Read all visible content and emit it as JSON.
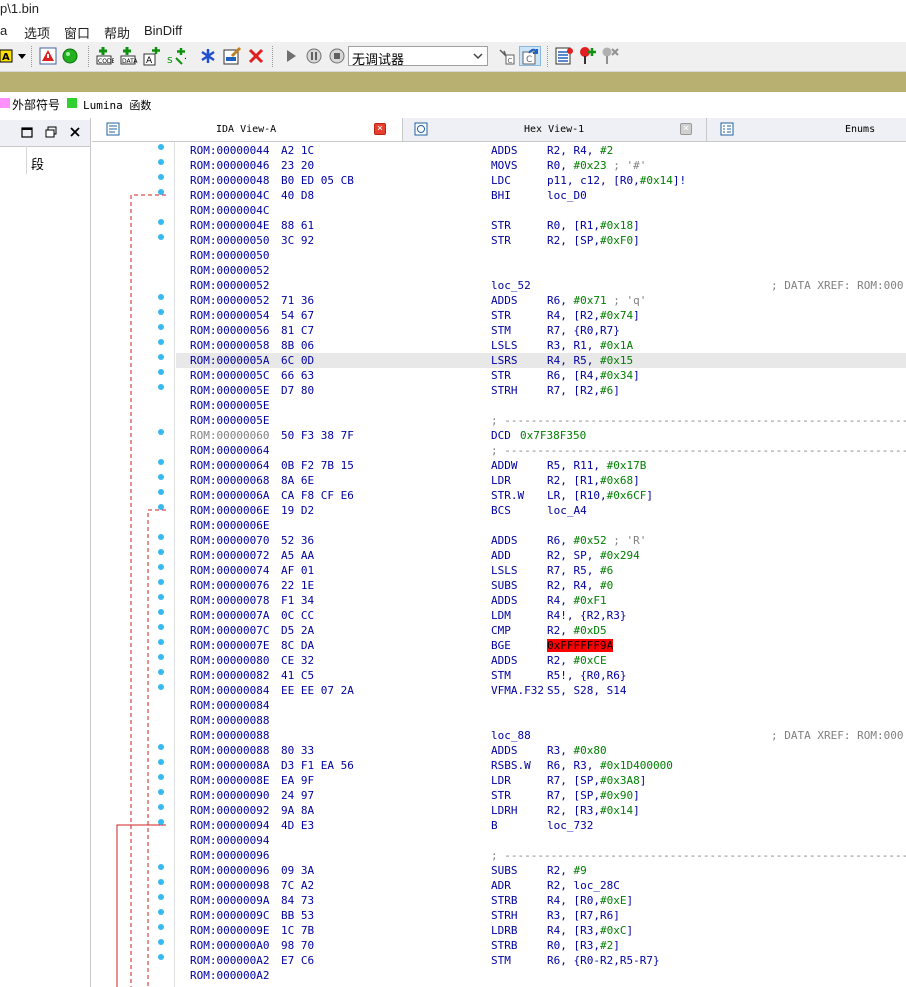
{
  "window": {
    "title": "p\\1.bin"
  },
  "menu": [
    "a",
    "选项",
    "窗口",
    "帮助",
    "BinDiff"
  ],
  "toolbar": {
    "debugger_select": "无调试器"
  },
  "legend": [
    {
      "color": "#ff90ff",
      "label": "外部符号"
    },
    {
      "color": "#30d030",
      "label": "Lumina 函数"
    }
  ],
  "left_panel": {
    "segment_label": "段"
  },
  "tabs": [
    {
      "label": "IDA View-A",
      "icon": "ida-view-icon"
    },
    {
      "label": "Hex View-1",
      "icon": "hex-view-icon"
    },
    {
      "label": "Enums",
      "icon": "enums-icon"
    }
  ],
  "listing": [
    {
      "addr": "ROM:00000044",
      "bytes": "A2 1C",
      "mnem": "ADDS",
      "ops": "R2, R4, #2",
      "dot": true
    },
    {
      "addr": "ROM:00000046",
      "bytes": "23 20",
      "mnem": "MOVS",
      "ops": "R0, #0x23 ; '#'",
      "dot": true
    },
    {
      "addr": "ROM:00000048",
      "bytes": "B0 ED 05 CB",
      "mnem": "LDC",
      "ops": "p11, c12, [R0,#0x14]!",
      "dot": true
    },
    {
      "addr": "ROM:0000004C",
      "bytes": "40 D8",
      "mnem": "BHI",
      "ops": "loc_D0",
      "dot": true
    },
    {
      "addr": "ROM:0000004C",
      "bytes": "",
      "mnem": "",
      "ops": "",
      "dot": false
    },
    {
      "addr": "ROM:0000004E",
      "bytes": "88 61",
      "mnem": "STR",
      "ops": "R0, [R1,#0x18]",
      "dot": true
    },
    {
      "addr": "ROM:00000050",
      "bytes": "3C 92",
      "mnem": "STR",
      "ops": "R2, [SP,#0xF0]",
      "dot": true
    },
    {
      "addr": "ROM:00000050",
      "bytes": "",
      "mnem": "",
      "ops": "",
      "dot": false
    },
    {
      "addr": "ROM:00000052",
      "bytes": "",
      "mnem": "",
      "ops": "",
      "dot": false
    },
    {
      "addr": "ROM:00000052",
      "bytes": "",
      "label": "loc_52",
      "xref": "; DATA XREF: ROM:000",
      "dot": false
    },
    {
      "addr": "ROM:00000052",
      "bytes": "71 36",
      "mnem": "ADDS",
      "ops": "R6, #0x71 ; 'q'",
      "dot": true
    },
    {
      "addr": "ROM:00000054",
      "bytes": "54 67",
      "mnem": "STR",
      "ops": "R4, [R2,#0x74]",
      "dot": true
    },
    {
      "addr": "ROM:00000056",
      "bytes": "81 C7",
      "mnem": "STM",
      "ops": "R7, {R0,R7}",
      "dot": true
    },
    {
      "addr": "ROM:00000058",
      "bytes": "8B 06",
      "mnem": "LSLS",
      "ops": "R3, R1, #0x1A",
      "dot": true
    },
    {
      "addr": "ROM:0000005A",
      "bytes": "6C 0D",
      "mnem": "LSRS",
      "ops": "R4, R5, #0x15",
      "dot": true,
      "hl": true
    },
    {
      "addr": "ROM:0000005C",
      "bytes": "66 63",
      "mnem": "STR",
      "ops": "R6, [R4,#0x34]",
      "dot": true
    },
    {
      "addr": "ROM:0000005E",
      "bytes": "D7 80",
      "mnem": "STRH",
      "ops": "R7, [R2,#6]",
      "dot": true
    },
    {
      "addr": "ROM:0000005E",
      "bytes": "",
      "mnem": "",
      "ops": "",
      "dot": false
    },
    {
      "addr": "ROM:0000005E",
      "bytes": "",
      "dash": "; ---------------------------------------------------------------------------",
      "dot": false
    },
    {
      "addr": "ROM:00000060",
      "bytes": "50 F3 38 7F",
      "mnem": "DCD",
      "ops": "0x7F38F350",
      "dot": true,
      "gray": true,
      "dcd": true
    },
    {
      "addr": "ROM:00000064",
      "bytes": "",
      "dash": "; ---------------------------------------------------------------------------",
      "dot": false
    },
    {
      "addr": "ROM:00000064",
      "bytes": "0B F2 7B 15",
      "mnem": "ADDW",
      "ops": "R5, R11, #0x17B",
      "dot": true
    },
    {
      "addr": "ROM:00000068",
      "bytes": "8A 6E",
      "mnem": "LDR",
      "ops": "R2, [R1,#0x68]",
      "dot": true
    },
    {
      "addr": "ROM:0000006A",
      "bytes": "CA F8 CF E6",
      "mnem": "STR.W",
      "ops": "LR, [R10,#0x6CF]",
      "dot": true
    },
    {
      "addr": "ROM:0000006E",
      "bytes": "19 D2",
      "mnem": "BCS",
      "ops": "loc_A4",
      "dot": true
    },
    {
      "addr": "ROM:0000006E",
      "bytes": "",
      "mnem": "",
      "ops": "",
      "dot": false
    },
    {
      "addr": "ROM:00000070",
      "bytes": "52 36",
      "mnem": "ADDS",
      "ops": "R6, #0x52 ; 'R'",
      "dot": true
    },
    {
      "addr": "ROM:00000072",
      "bytes": "A5 AA",
      "mnem": "ADD",
      "ops": "R2, SP, #0x294",
      "dot": true
    },
    {
      "addr": "ROM:00000074",
      "bytes": "AF 01",
      "mnem": "LSLS",
      "ops": "R7, R5, #6",
      "dot": true
    },
    {
      "addr": "ROM:00000076",
      "bytes": "22 1E",
      "mnem": "SUBS",
      "ops": "R2, R4, #0",
      "dot": true
    },
    {
      "addr": "ROM:00000078",
      "bytes": "F1 34",
      "mnem": "ADDS",
      "ops": "R4, #0xF1",
      "dot": true
    },
    {
      "addr": "ROM:0000007A",
      "bytes": "0C CC",
      "mnem": "LDM",
      "ops": "R4!, {R2,R3}",
      "dot": true
    },
    {
      "addr": "ROM:0000007C",
      "bytes": "D5 2A",
      "mnem": "CMP",
      "ops": "R2, #0xD5",
      "dot": true
    },
    {
      "addr": "ROM:0000007E",
      "bytes": "8C DA",
      "mnem": "BGE",
      "ops": "0xFFFFFF9A",
      "dot": true,
      "bad": true
    },
    {
      "addr": "ROM:00000080",
      "bytes": "CE 32",
      "mnem": "ADDS",
      "ops": "R2, #0xCE",
      "dot": true
    },
    {
      "addr": "ROM:00000082",
      "bytes": "41 C5",
      "mnem": "STM",
      "ops": "R5!, {R0,R6}",
      "dot": true
    },
    {
      "addr": "ROM:00000084",
      "bytes": "EE EE 07 2A",
      "mnem": "VFMA.F32",
      "ops": "S5, S28, S14",
      "dot": true
    },
    {
      "addr": "ROM:00000084",
      "bytes": "",
      "mnem": "",
      "ops": "",
      "dot": false
    },
    {
      "addr": "ROM:00000088",
      "bytes": "",
      "mnem": "",
      "ops": "",
      "dot": false
    },
    {
      "addr": "ROM:00000088",
      "bytes": "",
      "label": "loc_88",
      "xref": "; DATA XREF: ROM:000",
      "dot": false
    },
    {
      "addr": "ROM:00000088",
      "bytes": "80 33",
      "mnem": "ADDS",
      "ops": "R3, #0x80",
      "dot": true
    },
    {
      "addr": "ROM:0000008A",
      "bytes": "D3 F1 EA 56",
      "mnem": "RSBS.W",
      "ops": "R6, R3, #0x1D400000",
      "dot": true
    },
    {
      "addr": "ROM:0000008E",
      "bytes": "EA 9F",
      "mnem": "LDR",
      "ops": "R7, [SP,#0x3A8]",
      "dot": true
    },
    {
      "addr": "ROM:00000090",
      "bytes": "24 97",
      "mnem": "STR",
      "ops": "R7, [SP,#0x90]",
      "dot": true
    },
    {
      "addr": "ROM:00000092",
      "bytes": "9A 8A",
      "mnem": "LDRH",
      "ops": "R2, [R3,#0x14]",
      "dot": true
    },
    {
      "addr": "ROM:00000094",
      "bytes": "4D E3",
      "mnem": "B",
      "ops": "loc_732",
      "dot": true
    },
    {
      "addr": "ROM:00000094",
      "bytes": "",
      "mnem": "",
      "ops": "",
      "dot": false
    },
    {
      "addr": "ROM:00000096",
      "bytes": "",
      "dash": "; ---------------------------------------------------------------------------",
      "dot": false
    },
    {
      "addr": "ROM:00000096",
      "bytes": "09 3A",
      "mnem": "SUBS",
      "ops": "R2, #9",
      "dot": true
    },
    {
      "addr": "ROM:00000098",
      "bytes": "7C A2",
      "mnem": "ADR",
      "ops": "R2, loc_28C",
      "dot": true
    },
    {
      "addr": "ROM:0000009A",
      "bytes": "84 73",
      "mnem": "STRB",
      "ops": "R4, [R0,#0xE]",
      "dot": true
    },
    {
      "addr": "ROM:0000009C",
      "bytes": "BB 53",
      "mnem": "STRH",
      "ops": "R3, [R7,R6]",
      "dot": true
    },
    {
      "addr": "ROM:0000009E",
      "bytes": "1C 7B",
      "mnem": "LDRB",
      "ops": "R4, [R3,#0xC]",
      "dot": true
    },
    {
      "addr": "ROM:000000A0",
      "bytes": "98 70",
      "mnem": "STRB",
      "ops": "R0, [R3,#2]",
      "dot": true
    },
    {
      "addr": "ROM:000000A2",
      "bytes": "E7 C6",
      "mnem": "STM",
      "ops": "R6, {R0-R2,R5-R7}",
      "dot": true
    },
    {
      "addr": "ROM:000000A2",
      "bytes": "",
      "mnem": "",
      "ops": "",
      "dot": false
    }
  ]
}
